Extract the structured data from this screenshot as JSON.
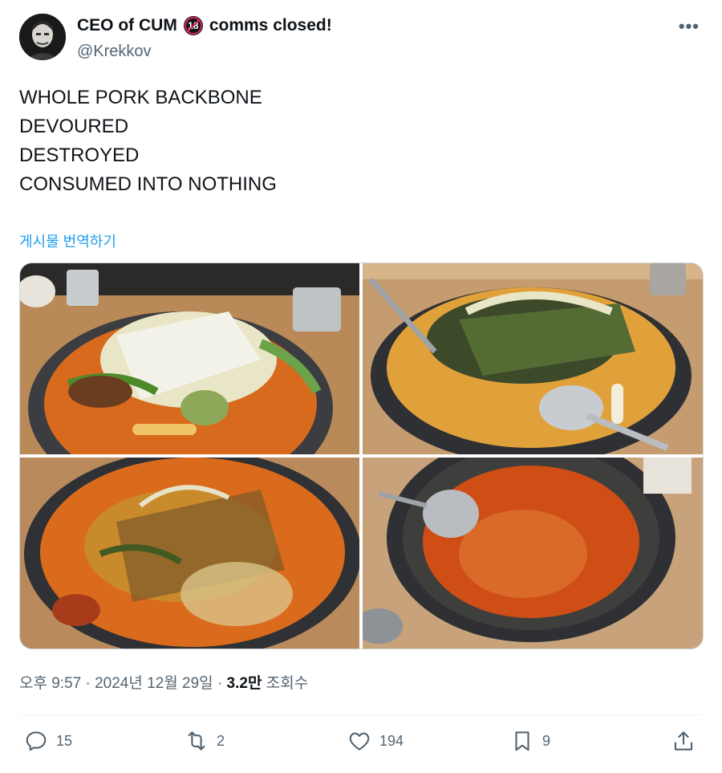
{
  "author": {
    "display_name_pre": "CEO of CUM",
    "badge": "18",
    "display_name_post": "comms closed!",
    "handle": "@Krekkov"
  },
  "tweet": {
    "lines": [
      "WHOLE PORK BACKBONE",
      "",
      "DEVOURED",
      "DESTROYED",
      "CONSUMED INTO NOTHING"
    ],
    "translate_link": "게시물 번역하기"
  },
  "meta": {
    "time": "오후 9:57",
    "separator": "·",
    "date": "2024년 12월 29일",
    "views_value": "3.2만",
    "views_label": "조회수"
  },
  "actions": {
    "replies": "15",
    "reposts": "2",
    "likes": "194",
    "bookmarks": "9"
  },
  "more_glyph": "•••"
}
